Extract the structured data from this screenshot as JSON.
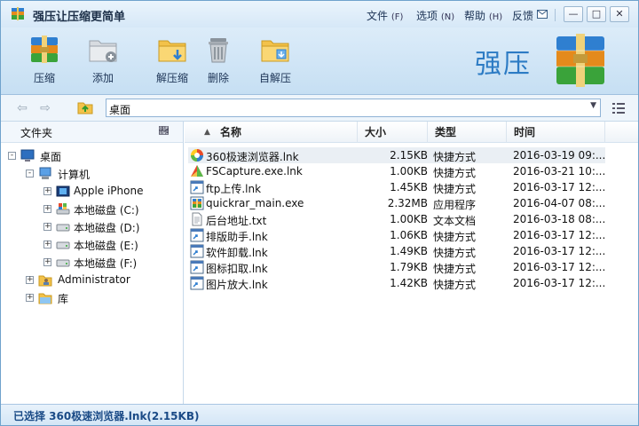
{
  "app": {
    "title": "强压让压缩更简单"
  },
  "menu": {
    "file": "文件",
    "file_key": "(F)",
    "options": "选项",
    "options_key": "(N)",
    "help": "帮助",
    "help_key": "(H)",
    "feedback": "反馈"
  },
  "toolbar": {
    "compress": "压缩",
    "add": "添加",
    "extract": "解压缩",
    "delete": "删除",
    "self_extract": "自解压",
    "brand": "强压"
  },
  "address": {
    "value": "桌面"
  },
  "tree": {
    "header": "文件夹",
    "items": [
      {
        "label": "桌面"
      },
      {
        "label": "计算机"
      },
      {
        "label": "Apple iPhone"
      },
      {
        "label": "本地磁盘 (C:)"
      },
      {
        "label": "本地磁盘 (D:)"
      },
      {
        "label": "本地磁盘 (E:)"
      },
      {
        "label": "本地磁盘 (F:)"
      },
      {
        "label": "Administrator"
      },
      {
        "label": "库"
      }
    ]
  },
  "files": {
    "columns": {
      "name": "名称",
      "size": "大小",
      "type": "类型",
      "time": "时间"
    },
    "rows": [
      {
        "name": "360极速浏览器.lnk",
        "size": "2.15KB",
        "type": "快捷方式",
        "time": "2016-03-19 09:..."
      },
      {
        "name": "FSCapture.exe.lnk",
        "size": "1.00KB",
        "type": "快捷方式",
        "time": "2016-03-21 10:..."
      },
      {
        "name": "ftp上传.lnk",
        "size": "1.45KB",
        "type": "快捷方式",
        "time": "2016-03-17 12:..."
      },
      {
        "name": "quickrar_main.exe",
        "size": "2.32MB",
        "type": "应用程序",
        "time": "2016-04-07 08:..."
      },
      {
        "name": "后台地址.txt",
        "size": "1.00KB",
        "type": "文本文档",
        "time": "2016-03-18 08:..."
      },
      {
        "name": "排版助手.lnk",
        "size": "1.06KB",
        "type": "快捷方式",
        "time": "2016-03-17 12:..."
      },
      {
        "name": "软件卸载.lnk",
        "size": "1.49KB",
        "type": "快捷方式",
        "time": "2016-03-17 12:..."
      },
      {
        "name": "图标扣取.lnk",
        "size": "1.79KB",
        "type": "快捷方式",
        "time": "2016-03-17 12:..."
      },
      {
        "name": "图片放大.lnk",
        "size": "1.42KB",
        "type": "快捷方式",
        "time": "2016-03-17 12:..."
      }
    ]
  },
  "status": {
    "text": "已选择 360极速浏览器.lnk(2.15KB)"
  },
  "colors": {
    "accent": "#2c7bc4",
    "toolbar_bg": "#d0e5f6",
    "status_text": "#1a4a86",
    "selected_row": "#eaeff4"
  }
}
